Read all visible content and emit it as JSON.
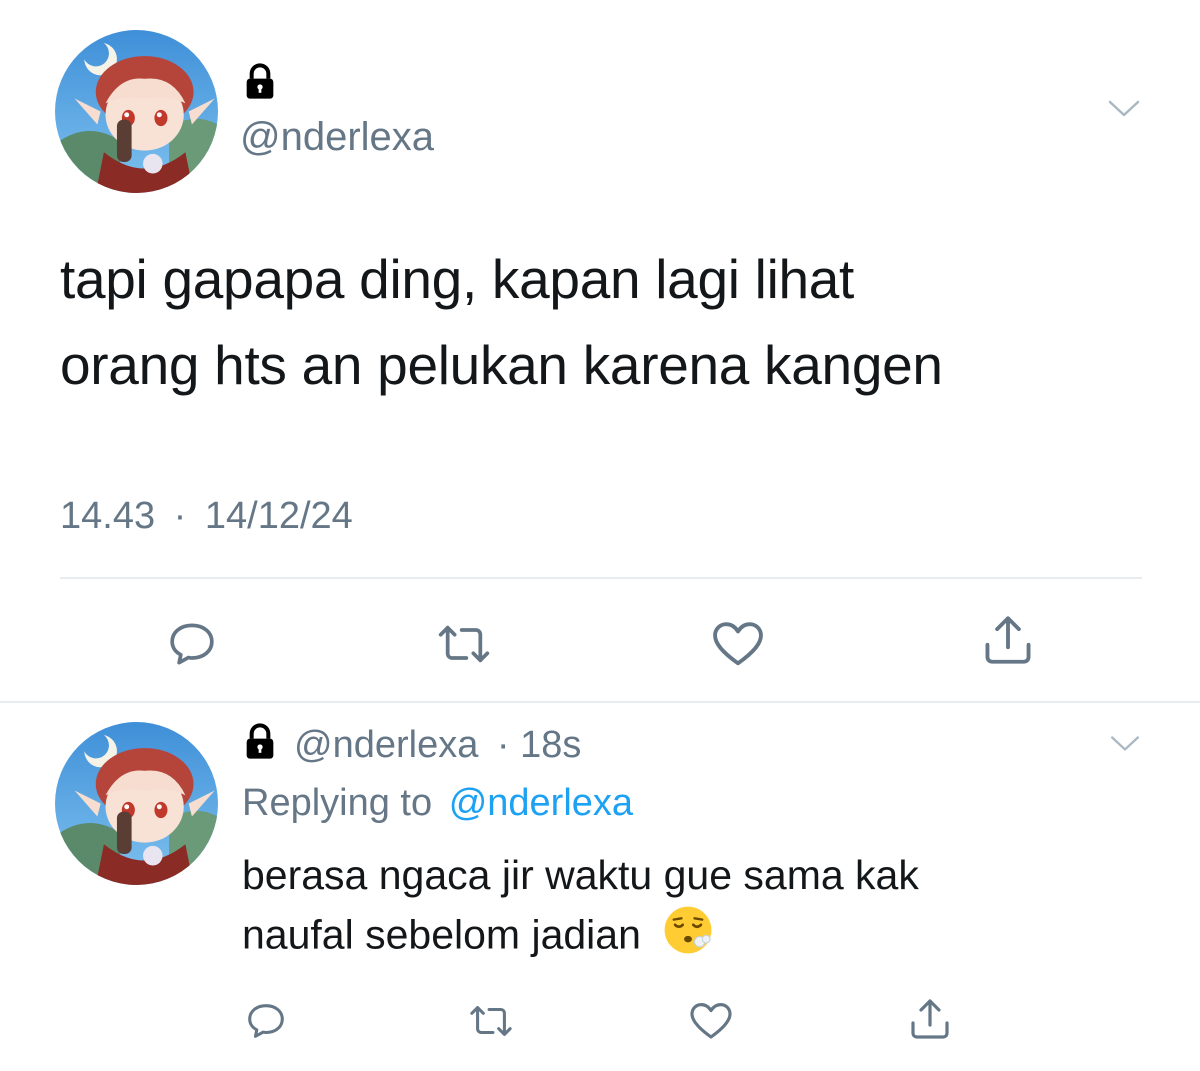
{
  "main_tweet": {
    "handle": "@nderlexa",
    "text_line1": "tapi gapapa ding, kapan lagi lihat",
    "text_line2": "orang hts an pelukan karena kangen",
    "time": "14.43",
    "separator": "·",
    "date": "14/12/24",
    "avatar_icon": "anime-character-avatar",
    "lock_icon": "lock-icon",
    "menu_icon": "chevron-down-icon",
    "actions": [
      "reply-icon",
      "retweet-icon",
      "like-icon",
      "share-icon"
    ]
  },
  "reply_tweet": {
    "handle": "@nderlexa",
    "time": "· 18s",
    "replying_prefix": "Replying to",
    "replying_to": "@nderlexa",
    "text_line1": "berasa ngaca jir waktu gue sama kak",
    "text_line2": "naufal sebelom jadian",
    "emoji": "😮‍💨"
  },
  "colors": {
    "text": "#14171a",
    "secondary": "#657786",
    "link": "#1da1f2",
    "divider": "#e6ecf0"
  }
}
